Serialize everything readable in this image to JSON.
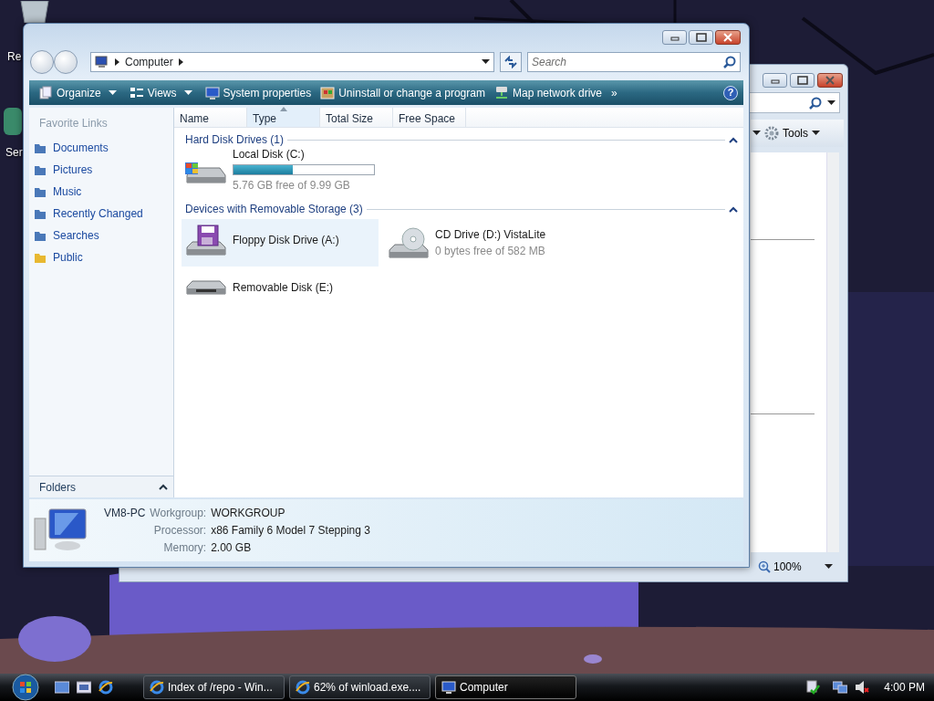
{
  "desktop": {
    "icons": [
      {
        "label": "Re"
      },
      {
        "label": "Ser"
      }
    ]
  },
  "background_window": {
    "tools": "Tools",
    "zoom": "100%"
  },
  "window": {
    "address": {
      "path": "Computer"
    },
    "search": {
      "placeholder": "Search"
    },
    "commands": [
      {
        "label": "Organize",
        "kind": "organize",
        "dropdown": true
      },
      {
        "label": "Views",
        "kind": "views",
        "dropdown": true
      },
      {
        "label": "System properties",
        "kind": "system",
        "dropdown": false
      },
      {
        "label": "Uninstall or change a program",
        "kind": "uninstall",
        "dropdown": false
      },
      {
        "label": "Map network drive",
        "kind": "network",
        "dropdown": false
      }
    ],
    "overflow": "»",
    "help": "?",
    "columns": [
      {
        "label": "Name",
        "sorted": false
      },
      {
        "label": "Type",
        "sorted": true
      },
      {
        "label": "Total Size",
        "sorted": false
      },
      {
        "label": "Free Space",
        "sorted": false
      }
    ],
    "sidebar": {
      "title": "Favorite Links",
      "items": [
        {
          "label": "Documents",
          "color": "#4a78b8"
        },
        {
          "label": "Pictures",
          "color": "#4a78b8"
        },
        {
          "label": "Music",
          "color": "#4a78b8"
        },
        {
          "label": "Recently Changed",
          "color": "#4a78b8"
        },
        {
          "label": "Searches",
          "color": "#4a78b8"
        },
        {
          "label": "Public",
          "color": "#e8b830"
        }
      ],
      "folders": "Folders"
    },
    "groups": [
      {
        "title": "Hard Disk Drives (1)",
        "expanded": true,
        "items": [
          {
            "kind": "hdd",
            "name": "Local Disk (C:)",
            "level": 0.42,
            "detail": "5.76 GB free of 9.99 GB",
            "selected": false
          }
        ]
      },
      {
        "title": "Devices with Removable Storage (3)",
        "expanded": true,
        "items": [
          {
            "kind": "floppy",
            "name": "Floppy Disk Drive (A:)",
            "selected": true
          },
          {
            "kind": "cd",
            "name": "CD Drive (D:) VistaLite",
            "detail": "0 bytes free of 582 MB",
            "selected": false
          },
          {
            "kind": "removable",
            "name": "Removable Disk (E:)",
            "selected": false
          }
        ]
      }
    ],
    "details": {
      "computer_name": "VM8-PC",
      "fields": [
        {
          "label": "Workgroup:",
          "value": "WORKGROUP"
        },
        {
          "label": "Processor:",
          "value": "x86 Family 6 Model 7 Stepping 3"
        },
        {
          "label": "Memory:",
          "value": "2.00 GB"
        }
      ]
    }
  },
  "taskbar": {
    "tasks": [
      {
        "label": "Index of /repo - Win...",
        "kind": "browser",
        "selected": false
      },
      {
        "label": "62% of winload.exe....",
        "kind": "browser",
        "selected": false
      },
      {
        "label": "Computer",
        "kind": "computer",
        "selected": true
      }
    ],
    "clock": "4:00 PM"
  }
}
